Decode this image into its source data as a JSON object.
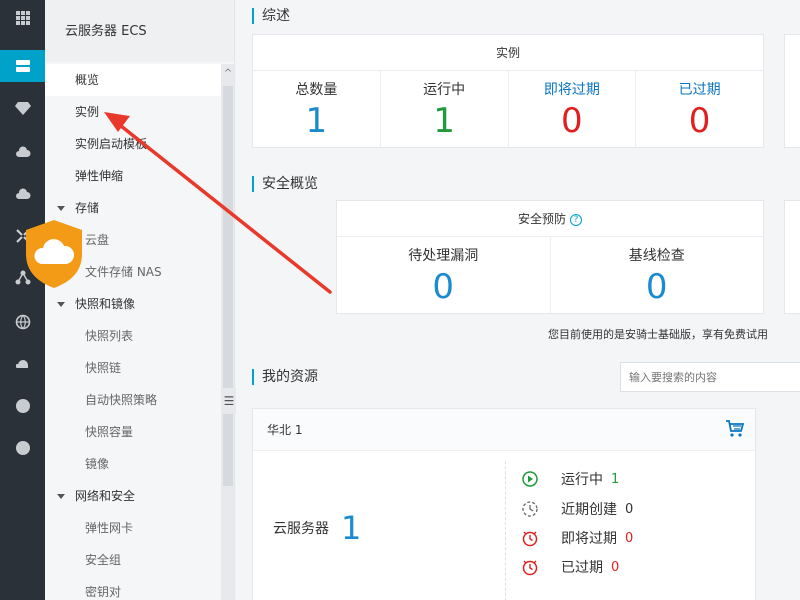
{
  "sidebar": {
    "title": "云服务器 ECS",
    "items": [
      {
        "label": "概览",
        "type": "item",
        "active": true
      },
      {
        "label": "实例",
        "type": "item"
      },
      {
        "label": "实例启动模板",
        "type": "item"
      },
      {
        "label": "弹性伸缩",
        "type": "item"
      },
      {
        "label": "存储",
        "type": "group"
      },
      {
        "label": "云盘",
        "type": "sub"
      },
      {
        "label": "文件存储 NAS",
        "type": "sub"
      },
      {
        "label": "快照和镜像",
        "type": "group"
      },
      {
        "label": "快照列表",
        "type": "sub"
      },
      {
        "label": "快照链",
        "type": "sub"
      },
      {
        "label": "自动快照策略",
        "type": "sub"
      },
      {
        "label": "快照容量",
        "type": "sub"
      },
      {
        "label": "镜像",
        "type": "sub"
      },
      {
        "label": "网络和安全",
        "type": "group"
      },
      {
        "label": "弹性网卡",
        "type": "sub"
      },
      {
        "label": "安全组",
        "type": "sub"
      },
      {
        "label": "密钥对",
        "type": "sub"
      }
    ]
  },
  "rail_icons": [
    "grid-icon",
    "server-icon",
    "diamond-icon",
    "cloud-upload-icon",
    "cloud-icon",
    "network-icon",
    "nodes-icon",
    "globe-icon",
    "support-icon",
    "circle-icon",
    "circle-icon"
  ],
  "overview": {
    "title": "综述",
    "instances": {
      "head": "实例",
      "cells": [
        {
          "label": "总数量",
          "value": "1",
          "color": "blue"
        },
        {
          "label": "运行中",
          "value": "1",
          "color": "green"
        },
        {
          "label": "即将过期",
          "value": "0",
          "color": "red",
          "link": true
        },
        {
          "label": "已过期",
          "value": "0",
          "color": "red",
          "link": true
        }
      ]
    }
  },
  "security": {
    "title": "安全概览",
    "head": "安全预防",
    "help": "?",
    "cells": [
      {
        "label": "待处理漏洞",
        "value": "0"
      },
      {
        "label": "基线检查",
        "value": "0"
      }
    ],
    "note": "您目前使用的是安骑士基础版，享有免费试用"
  },
  "resources": {
    "title": "我的资源",
    "search_placeholder": "输入要搜索的内容",
    "region": "华北 1",
    "left_label": "云服务器",
    "left_value": "1",
    "stats": [
      {
        "label": "运行中",
        "value": "1",
        "color": "green",
        "icon": "play-circle-icon"
      },
      {
        "label": "近期创建",
        "value": "0",
        "color": "dark",
        "icon": "clock-icon"
      },
      {
        "label": "即将过期",
        "value": "0",
        "color": "red",
        "icon": "alarm-icon"
      },
      {
        "label": "已过期",
        "value": "0",
        "color": "red",
        "icon": "alarm-icon"
      }
    ]
  },
  "colors": {
    "accent": "#00a2ca",
    "blue": "#1a8bd0",
    "green": "#1f9b3b",
    "red": "#e02020",
    "annotation": "#e8392b",
    "shield": "#f39a16"
  }
}
